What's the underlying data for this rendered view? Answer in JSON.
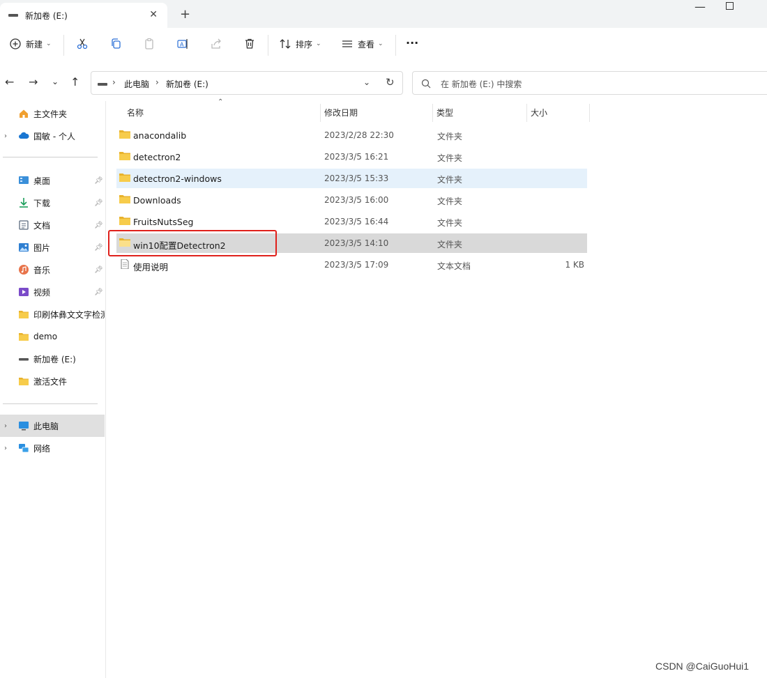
{
  "window": {
    "tab_title": "新加卷 (E:)",
    "tab_close": "✕",
    "new_tab": "+",
    "minimize": "—",
    "close": "✕"
  },
  "toolbar": {
    "new_label": "新建",
    "sort_label": "排序",
    "view_label": "查看",
    "more_label": "···"
  },
  "address": {
    "crumbs": [
      "此电脑",
      "新加卷 (E:)"
    ],
    "search_placeholder": "在 新加卷 (E:) 中搜索"
  },
  "sidebar": {
    "items": [
      {
        "label": "主文件夹",
        "icon": "home-icon"
      },
      {
        "label": "国敏 - 个人",
        "icon": "cloud-icon"
      },
      {
        "label": "桌面",
        "icon": "desktop-icon"
      },
      {
        "label": "下载",
        "icon": "download-icon"
      },
      {
        "label": "文档",
        "icon": "document-icon"
      },
      {
        "label": "图片",
        "icon": "picture-icon"
      },
      {
        "label": "音乐",
        "icon": "music-icon"
      },
      {
        "label": "视频",
        "icon": "video-icon"
      },
      {
        "label": "印刷体彝文文字检测",
        "icon": "folder-icon"
      },
      {
        "label": "demo",
        "icon": "folder-icon"
      },
      {
        "label": "新加卷 (E:)",
        "icon": "drive-icon"
      },
      {
        "label": "激活文件",
        "icon": "folder-icon"
      },
      {
        "label": "此电脑",
        "icon": "computer-icon"
      },
      {
        "label": "网络",
        "icon": "network-icon"
      }
    ]
  },
  "columns": {
    "name": "名称",
    "date": "修改日期",
    "type": "类型",
    "size": "大小"
  },
  "files": [
    {
      "name": "anacondalib",
      "date": "2023/2/28 22:30",
      "type": "文件夹",
      "size": ""
    },
    {
      "name": "detectron2",
      "date": "2023/3/5 16:21",
      "type": "文件夹",
      "size": ""
    },
    {
      "name": "detectron2-windows",
      "date": "2023/3/5 15:33",
      "type": "文件夹",
      "size": ""
    },
    {
      "name": "Downloads",
      "date": "2023/3/5 16:00",
      "type": "文件夹",
      "size": ""
    },
    {
      "name": "FruitsNutsSeg",
      "date": "2023/3/5 16:44",
      "type": "文件夹",
      "size": ""
    },
    {
      "name": "win10配置Detectron2",
      "date": "2023/3/5 14:10",
      "type": "文件夹",
      "size": ""
    },
    {
      "name": "使用说明",
      "date": "2023/3/5 17:09",
      "type": "文本文档",
      "size": "1 KB"
    }
  ],
  "watermark": "CSDN @CaiGuoHui1",
  "colors": {
    "accent_red": "#e0201b",
    "folder_yellow": "#f4c542",
    "selection_gray": "#d9d9d9",
    "hover_blue": "#e5f1fb"
  }
}
